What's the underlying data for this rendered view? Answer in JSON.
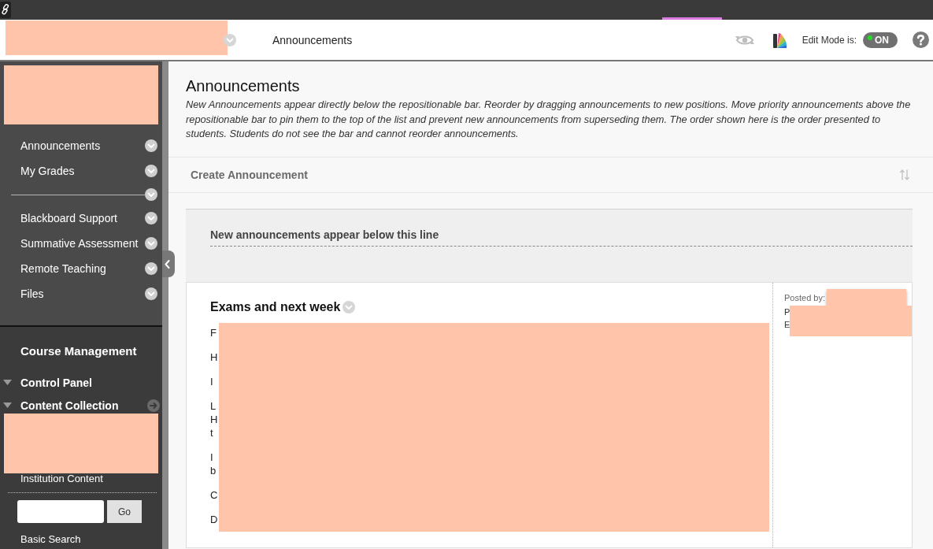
{
  "header": {
    "breadcrumb": "Announcements",
    "edit_mode": {
      "label": "Edit Mode is:",
      "toggle": "ON",
      "on": true
    }
  },
  "sidebar": {
    "menu": [
      {
        "kind": "link",
        "label": "Announcements"
      },
      {
        "kind": "link",
        "label": "My Grades"
      },
      {
        "kind": "divider"
      },
      {
        "kind": "link",
        "label": "Blackboard Support"
      },
      {
        "kind": "link",
        "label": "Summative Assessment"
      },
      {
        "kind": "link",
        "label": "Remote Teaching"
      },
      {
        "kind": "link",
        "label": "Files"
      }
    ]
  },
  "course_management": {
    "title": "Course Management",
    "sections": [
      {
        "label": "Control Panel",
        "expanded": true
      },
      {
        "label": "Content Collection",
        "expanded": true,
        "children": [
          {
            "kind": "redacted"
          },
          {
            "kind": "link",
            "label": "Institution Content"
          }
        ]
      }
    ],
    "search": {
      "button": "Go"
    },
    "basic_search": "Basic Search"
  },
  "content": {
    "title": "Announcements",
    "description": "New Announcements appear directly below the repositionable bar. Reorder by dragging announcements to new positions. Move priority announcements above the repositionable bar to pin them to the top of the list and prevent new announcements from superseding them. The order shown here is the order presented to students. Students do not see the bar and cannot reorder announcements.",
    "toolbar": {
      "create_button": "Create Announcement"
    },
    "reposition_bar": "New announcements appear below this line",
    "announcements": [
      {
        "title": "Exams and next week",
        "body": [
          [
            "F"
          ],
          [
            "H"
          ],
          [
            "I"
          ],
          [
            "L",
            "H",
            "t"
          ],
          [
            "I",
            "b"
          ],
          [
            "C"
          ],
          [
            "D"
          ]
        ],
        "meta": [
          "Posted by:",
          "P",
          "E"
        ]
      }
    ]
  }
}
